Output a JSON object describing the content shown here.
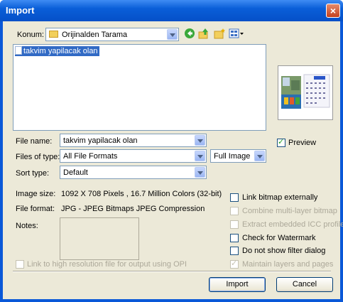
{
  "window": {
    "title": "Import",
    "close_glyph": "×"
  },
  "location": {
    "label": "Konum:",
    "value": "Orijinalden Tarama",
    "toolbar_icons": [
      "back-icon",
      "up-folder-icon",
      "new-folder-icon",
      "view-menu-icon"
    ]
  },
  "files": [
    {
      "name": "takvim yapilacak olan",
      "selected": true
    }
  ],
  "preview_checkbox": {
    "label": "Preview",
    "checked": true
  },
  "form": {
    "file_name_label": "File name:",
    "file_name_value": "takvim yapilacak olan",
    "files_of_type_label": "Files of type:",
    "files_of_type_value": "All File Formats",
    "image_mode_value": "Full Image",
    "sort_type_label": "Sort type:",
    "sort_type_value": "Default"
  },
  "info": {
    "image_size_label": "Image size:",
    "image_size_value": "1092 X 708 Pixels , 16.7 Million Colors (32-bit)",
    "file_format_label": "File format:",
    "file_format_value": "JPG - JPEG Bitmaps JPEG Compression",
    "notes_label": "Notes:"
  },
  "options": [
    {
      "label": "Link bitmap externally",
      "checked": false,
      "enabled": true
    },
    {
      "label": "Combine multi-layer bitmap",
      "checked": false,
      "enabled": false
    },
    {
      "label": "Extract embedded ICC profile",
      "checked": false,
      "enabled": false
    },
    {
      "label": "Check for Watermark",
      "checked": false,
      "enabled": true
    },
    {
      "label": "Do not show filter dialog",
      "checked": false,
      "enabled": true
    },
    {
      "label": "Maintain layers and pages",
      "checked": true,
      "enabled": false
    }
  ],
  "opi_checkbox": {
    "label": "Link to high resolution file for output using OPI",
    "checked": false,
    "enabled": false
  },
  "buttons": {
    "import": "Import",
    "cancel": "Cancel"
  },
  "colors": {
    "titlebar": "#0a5ed8",
    "client": "#ece9d8",
    "selection": "#316ac5"
  }
}
